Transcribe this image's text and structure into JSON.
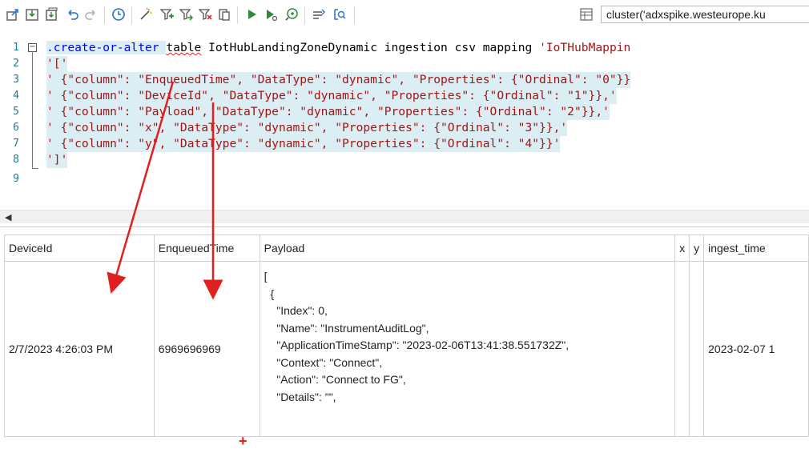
{
  "toolbar": {
    "cluster_text": "cluster('adxspike.westeurope.ku",
    "icons": [
      "export-icon",
      "save-icon",
      "save-all-icon",
      "undo-icon",
      "redo-icon",
      "history-icon",
      "format-icon",
      "new-query-icon",
      "share-icon",
      "share-results-icon",
      "copy-icon",
      "run-icon",
      "run-selection-icon",
      "recall-icon",
      "compare-icon",
      "refresh-icon",
      "cluster-icon"
    ]
  },
  "editor": {
    "line_numbers": [
      "1",
      "2",
      "3",
      "4",
      "5",
      "6",
      "7",
      "8",
      "9"
    ],
    "line1": {
      "cmd": ".create-or-alter",
      "table_kw": "table",
      "rest": " IotHubLandingZoneDynamic ingestion csv mapping ",
      "str": "'IoTHubMappin"
    },
    "lines": [
      "'['",
      "' {\"column\": \"EnqueuedTime\", \"DataType\": \"dynamic\", \"Properties\": {\"Ordinal\": \"0\"}}",
      "' {\"column\": \"DeviceId\", \"DataType\": \"dynamic\", \"Properties\": {\"Ordinal\": \"1\"}},'",
      "' {\"column\": \"Payload\", \"DataType\": \"dynamic\", \"Properties\": {\"Ordinal\": \"2\"}},'",
      "' {\"column\": \"x\", \"DataType\": \"dynamic\", \"Properties\": {\"Ordinal\": \"3\"}},'",
      "' {\"column\": \"y\", \"DataType\": \"dynamic\", \"Properties\": {\"Ordinal\": \"4\"}}'",
      "']'"
    ]
  },
  "grid": {
    "headers": [
      "DeviceId",
      "EnqueuedTime",
      "Payload",
      "x",
      "y",
      "ingest_time"
    ],
    "row": {
      "device_id": "2/7/2023 4:26:03 PM",
      "enqueued_time": "6969696969",
      "payload_lines": [
        "[",
        "  {",
        "    \"Index\": 0,",
        "    \"Name\": \"InstrumentAuditLog\",",
        "    \"ApplicationTimeStamp\": \"2023-02-06T13:41:38.551732Z\",",
        "    \"Context\": \"Connect\",",
        "    \"Action\": \"Connect to FG\",",
        "    \"Details\": \"\","
      ],
      "x": "",
      "y": "",
      "ingest_time": "2023-02-07 1"
    }
  },
  "annotations": {
    "plus": "+"
  },
  "colors": {
    "selection": "#dbeef3",
    "line_number": "#237893",
    "string": "#a31515",
    "keyword": "#0000ff",
    "arrow": "#e02020"
  }
}
